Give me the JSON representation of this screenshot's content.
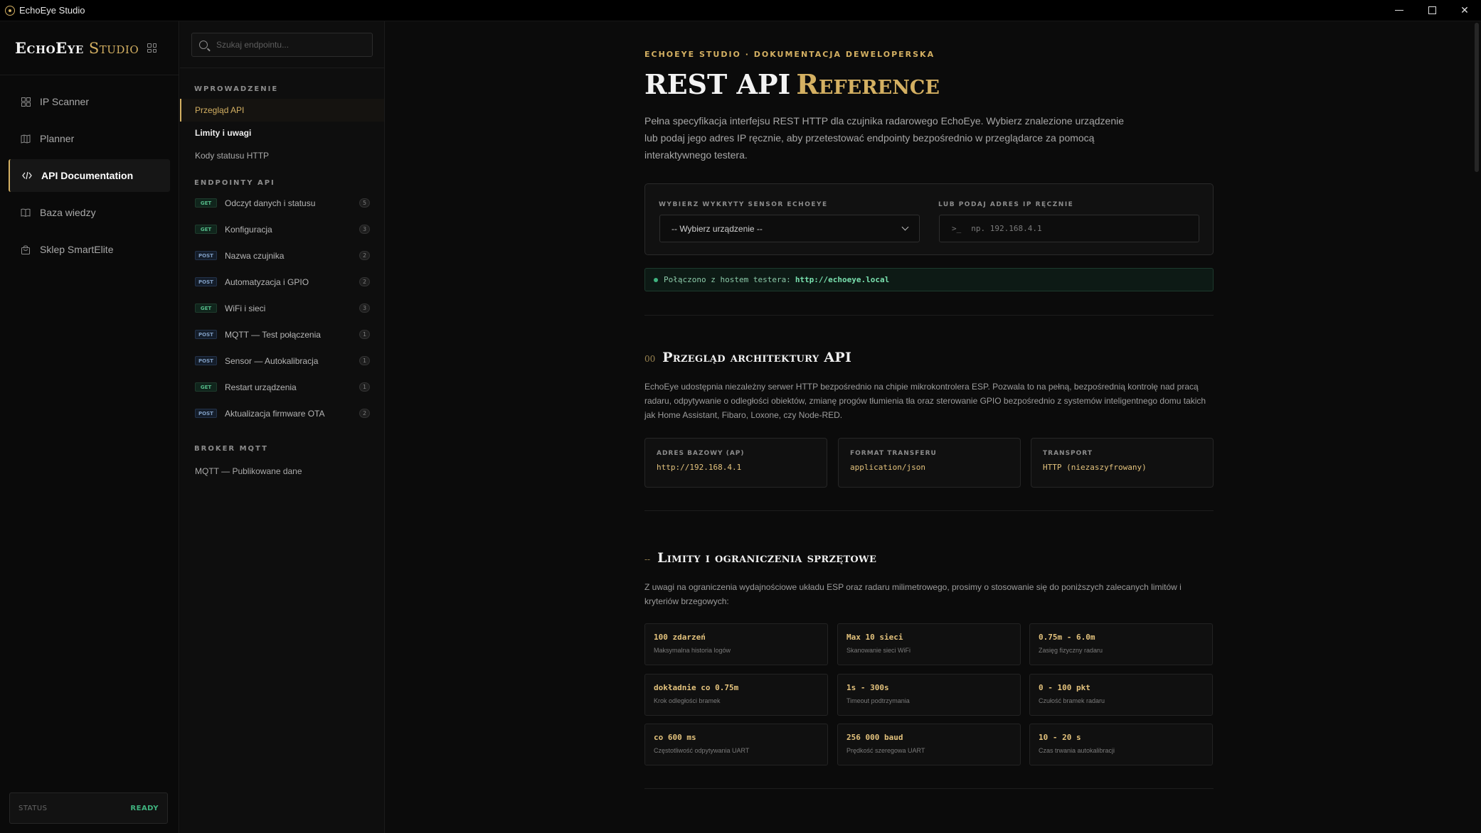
{
  "window": {
    "title": "EchoEye Studio"
  },
  "brand": {
    "name_a": "EchoEye",
    "name_b": "Studio"
  },
  "nav": {
    "items": [
      {
        "label": "IP Scanner",
        "icon": "grid-icon"
      },
      {
        "label": "Planner",
        "icon": "map-icon"
      },
      {
        "label": "API Documentation",
        "icon": "code-icon",
        "active": true
      },
      {
        "label": "Baza wiedzy",
        "icon": "book-icon"
      },
      {
        "label": "Sklep SmartElite",
        "icon": "bag-icon"
      }
    ],
    "status_label": "STATUS",
    "status_value": "READY"
  },
  "side": {
    "search_placeholder": "Szukaj endpointu...",
    "sections": [
      {
        "title": "WPROWADZENIE",
        "links": [
          "Przegląd API",
          "Limity i uwagi",
          "Kody statusu HTTP"
        ]
      },
      {
        "title": "ENDPOINTY API"
      },
      {
        "title": "BROKER MQTT",
        "links": [
          "MQTT — Publikowane dane"
        ]
      }
    ],
    "endpoints": [
      {
        "method": "GET",
        "label": "Odczyt danych i statusu",
        "count": "5"
      },
      {
        "method": "GET",
        "label": "Konfiguracja",
        "count": "3"
      },
      {
        "method": "POST",
        "label": "Nazwa czujnika",
        "count": "2"
      },
      {
        "method": "POST",
        "label": "Automatyzacja i GPIO",
        "count": "2"
      },
      {
        "method": "GET",
        "label": "WiFi i sieci",
        "count": "3"
      },
      {
        "method": "POST",
        "label": "MQTT — Test połączenia",
        "count": "1"
      },
      {
        "method": "POST",
        "label": "Sensor — Autokalibracja",
        "count": "1"
      },
      {
        "method": "GET",
        "label": "Restart urządzenia",
        "count": "1"
      },
      {
        "method": "POST",
        "label": "Aktualizacja firmware OTA",
        "count": "2"
      }
    ]
  },
  "main": {
    "eyebrow": "ECHOEYE STUDIO · DOKUMENTACJA DEWELOPERSKA",
    "title_a": "REST API",
    "title_b": "Reference",
    "lead": "Pełna specyfikacja interfejsu REST HTTP dla czujnika radarowego EchoEye. Wybierz znalezione urządzenie lub podaj jego adres IP ręcznie, aby przetestować endpointy bezpośrednio w przeglądarce za pomocą interaktywnego testera.",
    "device_label": "WYBIERZ WYKRYTY SENSOR ECHOEYE",
    "device_select": "-- Wybierz urządzenie --",
    "ip_label": "LUB PODAJ ADRES IP RĘCZNIE",
    "ip_prompt": ">_",
    "ip_placeholder": "np. 192.168.4.1",
    "connected_text": "Połączono z hostem testera:",
    "connected_url": "http://echoeye.local",
    "section0": {
      "num": "00",
      "title": "Przegląd architektury API",
      "text": "EchoEye udostępnia niezależny serwer HTTP bezpośrednio na chipie mikrokontrolera ESP. Pozwala to na pełną, bezpośrednią kontrolę nad pracą radaru, odpytywanie o odległości obiektów, zmianę progów tłumienia tła oraz sterowanie GPIO bezpośrednio z systemów inteligentnego domu takich jak Home Assistant, Fibaro, Loxone, czy Node-RED.",
      "cards": [
        {
          "k": "ADRES BAZOWY (AP)",
          "v": "http://192.168.4.1"
        },
        {
          "k": "FORMAT TRANSFERU",
          "v": "application/json"
        },
        {
          "k": "TRANSPORT",
          "v": "HTTP (niezaszyfrowany)"
        }
      ]
    },
    "section1": {
      "num": "--",
      "title": "Limity i ograniczenia sprzętowe",
      "text": "Z uwagi na ograniczenia wydajnościowe układu ESP oraz radaru milimetrowego, prosimy o stosowanie się do poniższych zalecanych limitów i kryteriów brzegowych:",
      "limits": [
        {
          "v": "100 zdarzeń",
          "k": "Maksymalna historia logów"
        },
        {
          "v": "Max 10 sieci",
          "k": "Skanowanie sieci WiFi"
        },
        {
          "v": "0.75m - 6.0m",
          "k": "Zasięg fizyczny radaru"
        },
        {
          "v": "dokładnie co 0.75m",
          "k": "Krok odległości bramek"
        },
        {
          "v": "1s - 300s",
          "k": "Timeout podtrzymania"
        },
        {
          "v": "0 - 100 pkt",
          "k": "Czułość bramek radaru"
        },
        {
          "v": "co 600 ms",
          "k": "Częstotliwość odpytywania UART"
        },
        {
          "v": "256 000 baud",
          "k": "Prędkość szeregowa UART"
        },
        {
          "v": "10 - 20 s",
          "k": "Czas trwania autokalibracji"
        }
      ]
    }
  }
}
